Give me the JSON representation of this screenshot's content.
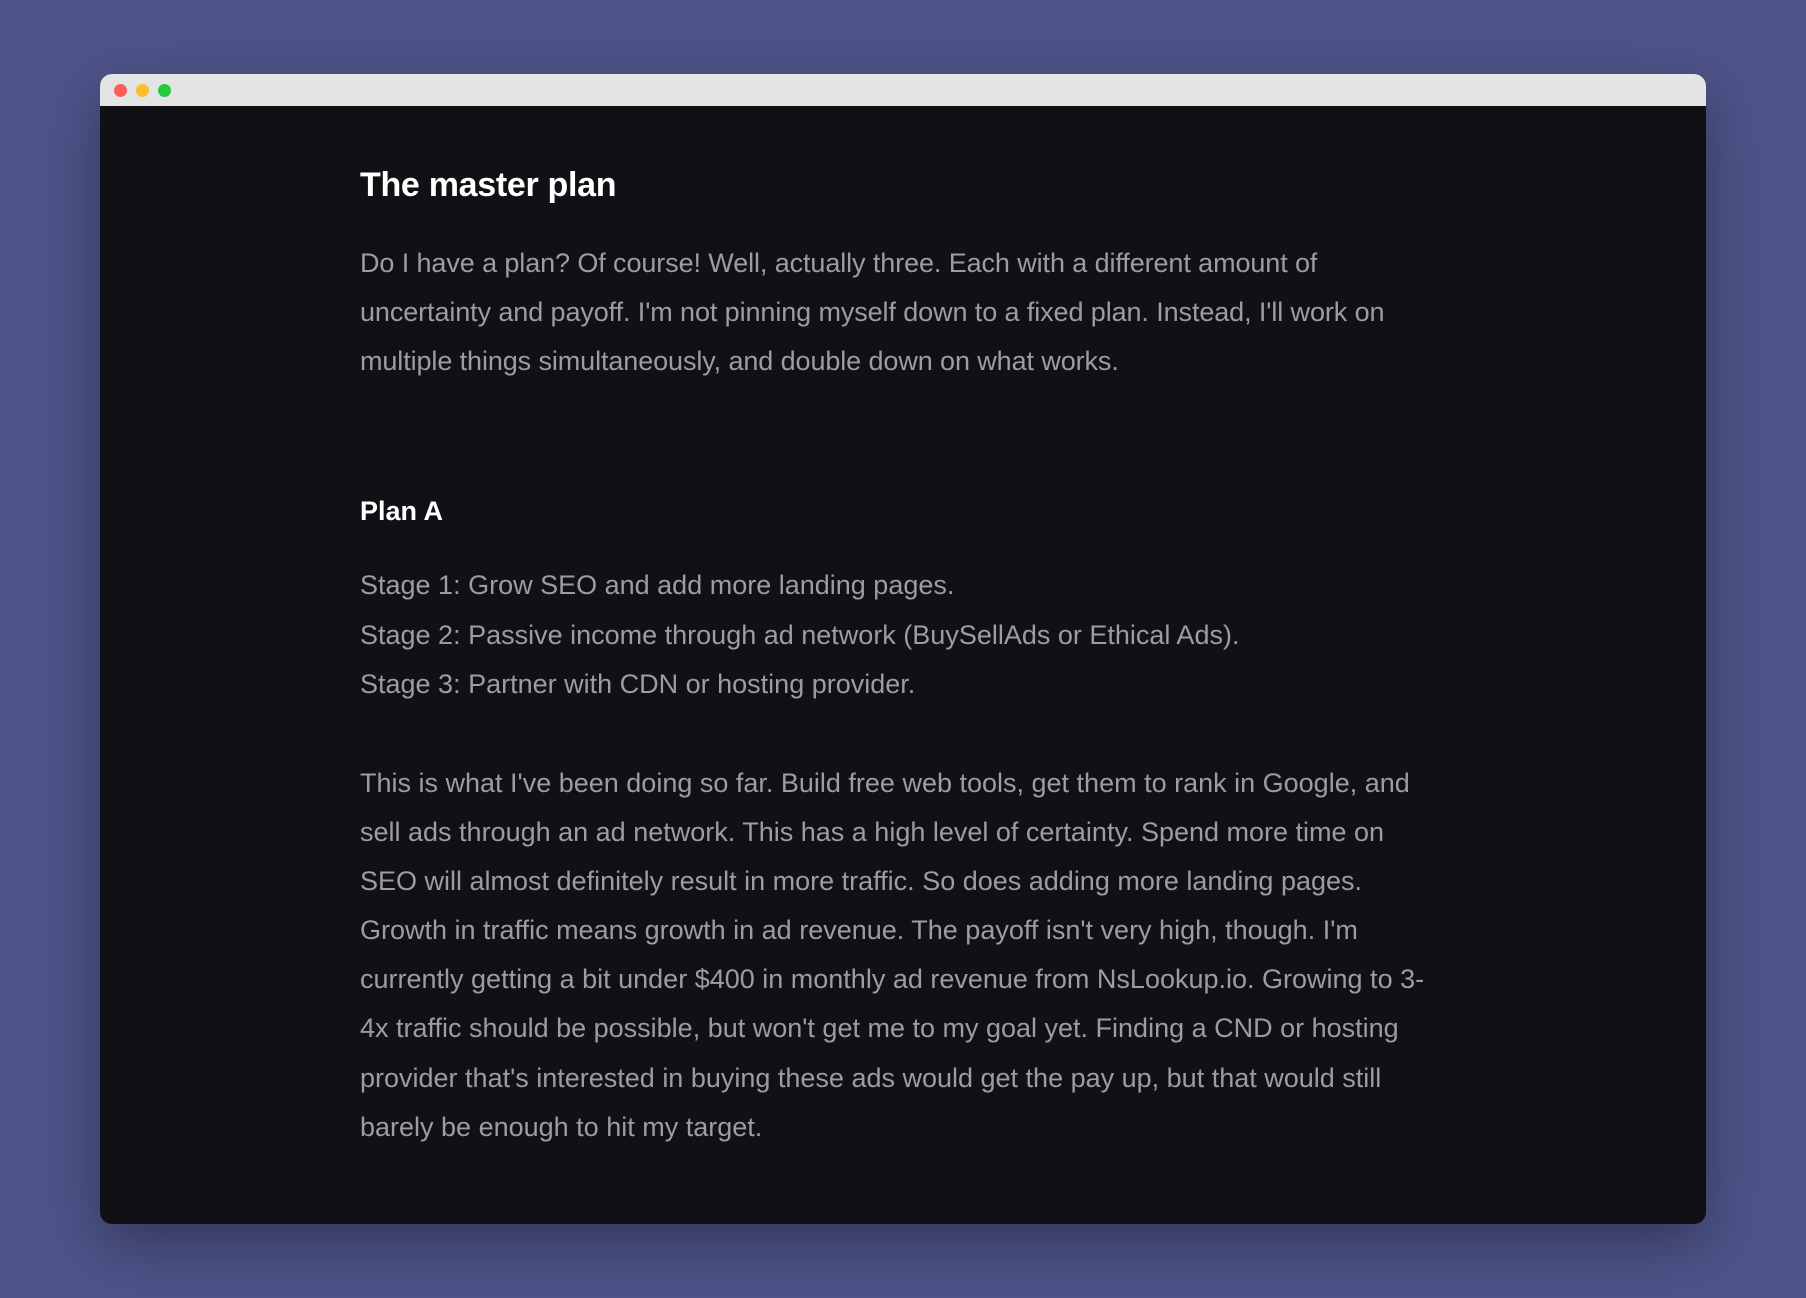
{
  "document": {
    "title": "The master plan",
    "intro": "Do I have a plan? Of course! Well, actually three. Each with a different amount of uncertainty and payoff. I'm not pinning myself down to a fixed plan. Instead, I'll work on multiple things simultaneously, and double down on what works.",
    "plan_a": {
      "heading": "Plan A",
      "stages": [
        "Stage 1: Grow SEO and add more landing pages.",
        "Stage 2: Passive income through ad network (BuySellAds or Ethical Ads).",
        "Stage 3: Partner with CDN or hosting provider."
      ],
      "body": "This is what I've been doing so far. Build free web tools, get them to rank in Google, and sell ads through an ad network. This has a high level of certainty. Spend more time on SEO will almost definitely result in more traffic. So does adding more landing pages. Growth in traffic means growth in ad revenue. The payoff isn't very high, though. I'm currently getting a bit under $400 in monthly ad revenue from NsLookup.io. Growing to 3-4x traffic should be possible, but won't get me to my goal yet. Finding a CND or hosting provider that's interested in buying these ads would get the pay up, but that would still barely be enough to hit my target."
    }
  }
}
